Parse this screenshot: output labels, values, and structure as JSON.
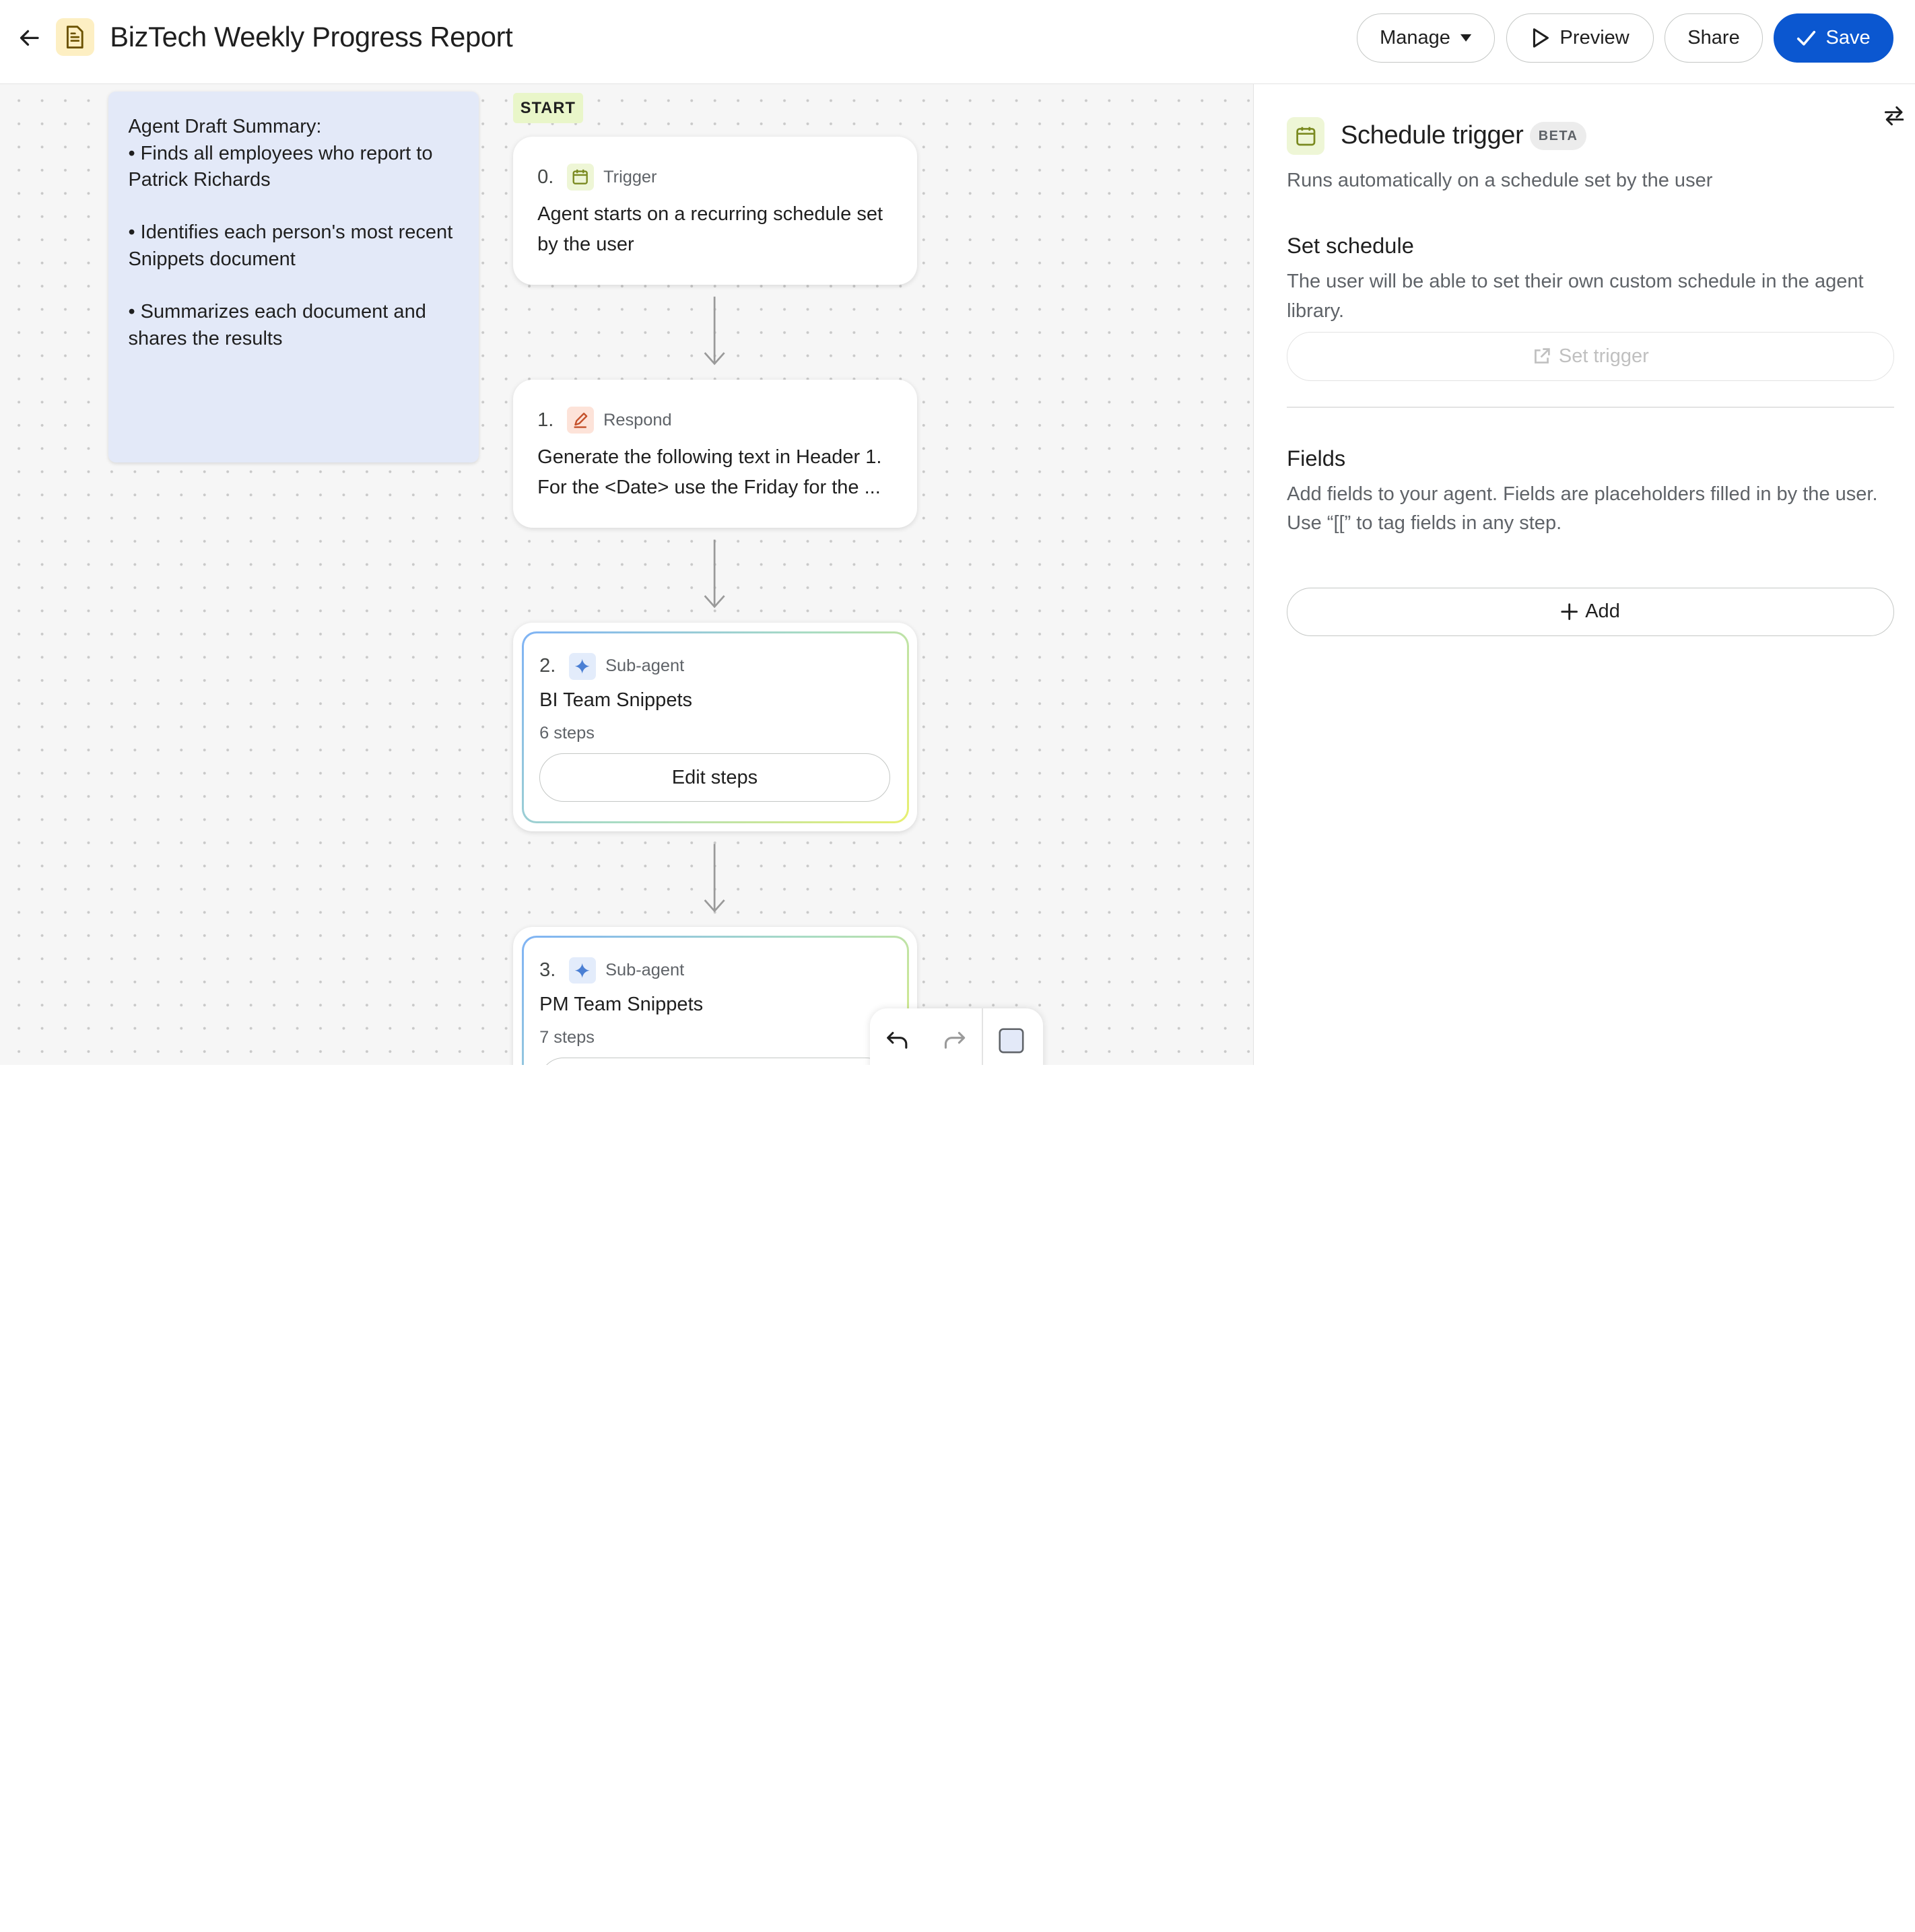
{
  "header": {
    "title": "BizTech Weekly Progress Report",
    "manage_label": "Manage",
    "preview_label": "Preview",
    "share_label": "Share",
    "save_label": "Save"
  },
  "canvas": {
    "note": {
      "heading": "Agent Draft Summary:",
      "bullets": [
        "• Finds all employees who report to Patrick Richards",
        "• Identifies each person's most recent Snippets document",
        "• Summarizes each document and shares the results"
      ]
    },
    "start_label": "START",
    "steps": [
      {
        "number": "0.",
        "type": "Trigger",
        "text": "Agent starts on a recurring schedule set by the user"
      },
      {
        "number": "1.",
        "type": "Respond",
        "line1": "Generate the following text in Header 1.",
        "line2": "For the <Date> use the Friday for the ..."
      },
      {
        "number": "2.",
        "type": "Sub-agent",
        "title": "BI Team Snippets",
        "steps": "6 steps",
        "button": "Edit steps"
      },
      {
        "number": "3.",
        "type": "Sub-agent",
        "title": "PM Team Snippets",
        "steps": "7 steps"
      }
    ]
  },
  "panel": {
    "title": "Schedule trigger",
    "badge": "BETA",
    "subtitle": "Runs automatically on a schedule set by the user",
    "schedule": {
      "heading": "Set schedule",
      "description": "The user will be able to set their own custom schedule in the agent library.",
      "button": "Set trigger"
    },
    "fields": {
      "heading": "Fields",
      "description": "Add fields to your agent. Fields are placeholders filled in by the user. Use “[[” to tag fields in any step.",
      "button": "Add"
    }
  },
  "colors": {
    "accent": "#0b57d0",
    "note_bg": "#e3e9f8",
    "start_bg": "#e9f6c9",
    "doc_badge": "#fdefc3"
  }
}
